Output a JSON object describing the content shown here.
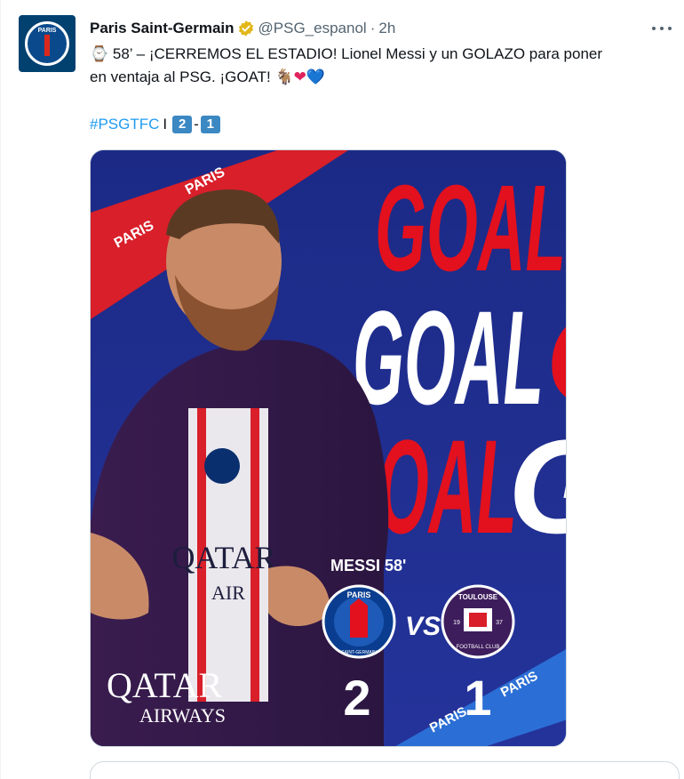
{
  "tweet": {
    "display_name": "Paris Saint-Germain",
    "handle": "@PSG_espanol",
    "separator": "·",
    "time": "2h",
    "text_line1": "⌚ 58’ – ¡CERREMOS EL ESTADIO! Lionel Messi y un GOLAZO para poner",
    "text_line2_main": "en ventaja al PSG. ¡GOAT! 🐐",
    "heart_red": "❤",
    "heart_blue": "💙",
    "hashtag": "#PSGTFC",
    "score_sep": "I",
    "score_home": "2",
    "score_dash": "-",
    "score_away": "1",
    "avatar_label": "PARIS"
  },
  "graphic": {
    "goal_word": "GOAL",
    "scorer": "MESSI 58'",
    "vs": "VS",
    "home_score": "2",
    "away_score": "1",
    "sponsor_line1": "QATAR",
    "sponsor_line2": "AIRWAYS",
    "shirt_sponsor": "QATAR",
    "shirt_sponsor2": "AIR",
    "psg_badge_text": "PARIS",
    "psg_badge_sub": "SAINT-GERMAIN",
    "tfc_badge_text": "TOULOUSE",
    "tfc_badge_sub": "FOOTBALL CLUB",
    "tfc_year_left": "19",
    "tfc_year_right": "37",
    "tape_word": "PARIS"
  },
  "colors": {
    "verified_gold": "#e2b719",
    "hashtag_blue": "#1d9bf0",
    "graphic_bg": "#1f2e8f",
    "goal_red": "#e3101d",
    "goal_white": "#ffffff"
  }
}
